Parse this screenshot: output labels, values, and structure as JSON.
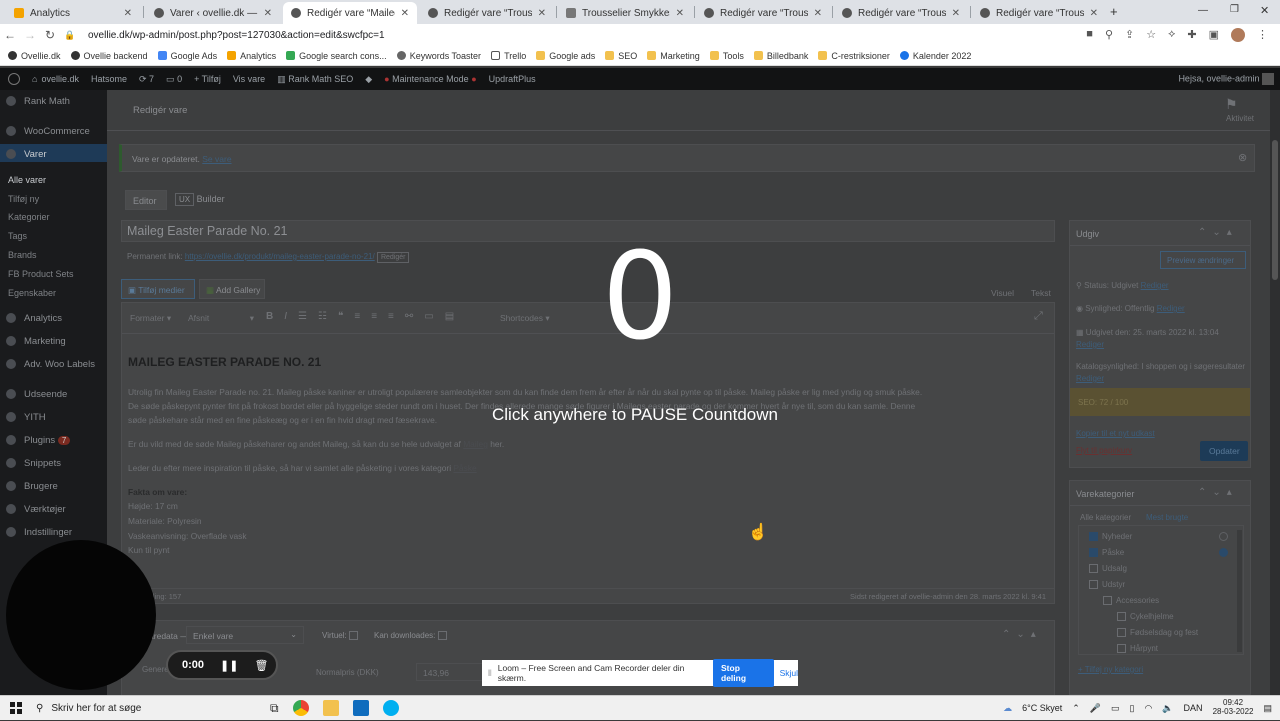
{
  "browser": {
    "tabs": [
      {
        "title": "Analytics",
        "color": "#f4a300"
      },
      {
        "title": "Varer ‹ ovellie.dk — WordF",
        "color": "#555555"
      },
      {
        "title": "Redigér vare “Maileg",
        "color": "#555555"
      },
      {
        "title": "Redigér vare “Trousselier",
        "color": "#555555"
      },
      {
        "title": "Trousselier Smykkeskrin M",
        "color": "#777777"
      },
      {
        "title": "Redigér vare “Trousselier",
        "color": "#555555"
      },
      {
        "title": "Redigér vare “Trousselier",
        "color": "#555555"
      },
      {
        "title": "Redigér vare “Trousselier",
        "color": "#555555"
      }
    ],
    "url": "ovellie.dk/wp-admin/post.php?post=127030&action=edit&swcfpc=1",
    "bookmarks": [
      "Ovellie.dk",
      "Ovellie backend",
      "Google Ads",
      "Analytics",
      "Google search cons...",
      "Keywords Toaster",
      "Trello",
      "Google ads",
      "SEO",
      "Marketing",
      "Tools",
      "Billedbank",
      "C-restriksioner",
      "Kalender 2022"
    ]
  },
  "adminbar": {
    "site": "ovellie.dk",
    "items": [
      "Hatsome",
      "7",
      "0",
      "+ Tilføj",
      "Vis vare",
      "Rank Math SEO",
      "Maintenance Mode",
      "UpdraftPlus"
    ],
    "greeting": "Hejsa, ovellie-admin"
  },
  "sidebar": {
    "items": [
      {
        "label": "Rank Math",
        "type": "main"
      },
      {
        "label": "WooCommerce",
        "type": "main"
      },
      {
        "label": "Varer",
        "type": "main"
      },
      {
        "label": "Alle varer",
        "type": "sub-active"
      },
      {
        "label": "Tilføj ny",
        "type": "sub"
      },
      {
        "label": "Kategorier",
        "type": "sub"
      },
      {
        "label": "Tags",
        "type": "sub"
      },
      {
        "label": "Brands",
        "type": "sub"
      },
      {
        "label": "FB Product Sets",
        "type": "sub"
      },
      {
        "label": "Egenskaber",
        "type": "sub"
      },
      {
        "label": "Analytics",
        "type": "main"
      },
      {
        "label": "Marketing",
        "type": "main"
      },
      {
        "label": "Adv. Woo Labels",
        "type": "main"
      },
      {
        "label": "Udseende",
        "type": "main"
      },
      {
        "label": "YITH",
        "type": "main"
      },
      {
        "label": "Plugins",
        "type": "main"
      },
      {
        "label": "Snippets",
        "type": "main"
      },
      {
        "label": "Brugere",
        "type": "main"
      },
      {
        "label": "Værktøjer",
        "type": "main"
      },
      {
        "label": "Indstillinger",
        "type": "main"
      }
    ],
    "plugins_badge": "7"
  },
  "editor": {
    "header": "Redigér vare",
    "activity": "Aktivitet",
    "notice": "Vare er opdateret.",
    "notice_link": "Se vare",
    "tab_editor": "Editor",
    "tab_ux": "UX",
    "tab_builder": "Builder",
    "title": "Maileg Easter Parade No. 21",
    "permalink_label": "Permanent link:",
    "permalink": "https://ovellie.dk/produkt/maileg-easter-parade-no-21/",
    "permalink_edit": "Redigér",
    "add_media": "Tilføj medier",
    "add_gallery": "Add Gallery",
    "visual": "Visuel",
    "text_tab": "Tekst",
    "toolbar_format": "Formater",
    "toolbar_paragraph": "Afsnit",
    "toolbar_shortcodes": "Shortcodes",
    "content_heading": "MAILEG EASTER PARADE NO. 21",
    "para1_line1": "Utrolig fin Maileg Easter Parade no. 21. Maileg påske kaniner er utroligt populærere samleobjekter som du  kan finde dem frem år efter år når du skal pynte op til påske. Maileg påske er lig med yndig og smuk påske.",
    "para1_line2": "De søde påskepynt pynter fint på frokost bordet eller på hyggelige steder rundt om i huset. Der findes allerede mange søde figurer i Mailegs easter parade og der kommer hvert år nye til, som du kan samle. Denne",
    "para1_line3": "søde påskehare står med en fine påskeæg og er i en fin hvid dragt med fæsekrave.",
    "para2": "Er du vild med de søde Maileg påskeharer og andet Maileg, så kan du se hele udvalget af",
    "para2_link": "Maileg",
    "para2_end": "her.",
    "para3": "Leder du efter mere inspiration til påske, så har vi samlet alle påsketing i vores kategori",
    "para3_link": "Påske",
    "facts_title": "Fakta om vare:",
    "facts": [
      "Højde: 17 cm",
      "Materiale: Polyresin",
      "Vaskeanvisning: Overflade vask",
      "Kun til pynt"
    ],
    "word_count": "Ordtælling: 157",
    "last_edited": "Sidst redigeret af ovellie-admin den 28. marts 2022 kl. 9:41",
    "product_data_label": "Varedata —",
    "product_type": "Enkel vare",
    "virtual": "Virtuel:",
    "downloadable": "Kan downloades:",
    "general_tab": "Generelt",
    "regular_price_label": "Normalpris (DKK)",
    "regular_price": "143,96"
  },
  "publish": {
    "title": "Udgiv",
    "preview": "Preview ændringer",
    "status": "Status: Udgivet",
    "status_edit": "Rediger",
    "visibility": "Synlighed: Offentlig",
    "visibility_edit": "Rediger",
    "published": "Udgivet den: 25. marts 2022 kl. 13:04",
    "published_edit": "Rediger",
    "catalog": "Katalogsynlighed: I shoppen og i søgeresultater",
    "catalog_edit": "Rediger",
    "seo": "SEO: 72 / 100",
    "copy_draft": "Kopier til et nyt udkast",
    "trash": "Flyt til papirkurv",
    "update": "Opdater"
  },
  "categories": {
    "title": "Varekategorier",
    "tab_all": "Alle kategorier",
    "tab_used": "Mest brugte",
    "items": [
      {
        "label": "Nyheder",
        "checked": true,
        "indent": 0
      },
      {
        "label": "Påske",
        "checked": true,
        "indent": 0
      },
      {
        "label": "Udsalg",
        "checked": false,
        "indent": 0
      },
      {
        "label": "Udstyr",
        "checked": false,
        "indent": 0
      },
      {
        "label": "Accessories",
        "checked": false,
        "indent": 1
      },
      {
        "label": "Cykelhjelme",
        "checked": false,
        "indent": 2
      },
      {
        "label": "Fødselsdag og fest",
        "checked": false,
        "indent": 2
      },
      {
        "label": "Hårpynt",
        "checked": false,
        "indent": 2
      }
    ],
    "add_new": "+ Tilføj ny kategori"
  },
  "overlay": {
    "countdown": "0",
    "message": "Click anywhere to PAUSE Countdown",
    "timer": "0:00"
  },
  "loom": {
    "message": "Loom – Free Screen and Cam Recorder deler din skærm.",
    "stop": "Stop deling",
    "hide": "Skjul"
  },
  "taskbar": {
    "search_placeholder": "Skriv her for at søge",
    "weather": "6°C  Skyet",
    "lang": "DAN",
    "time": "09:42",
    "date": "28-03-2022"
  }
}
